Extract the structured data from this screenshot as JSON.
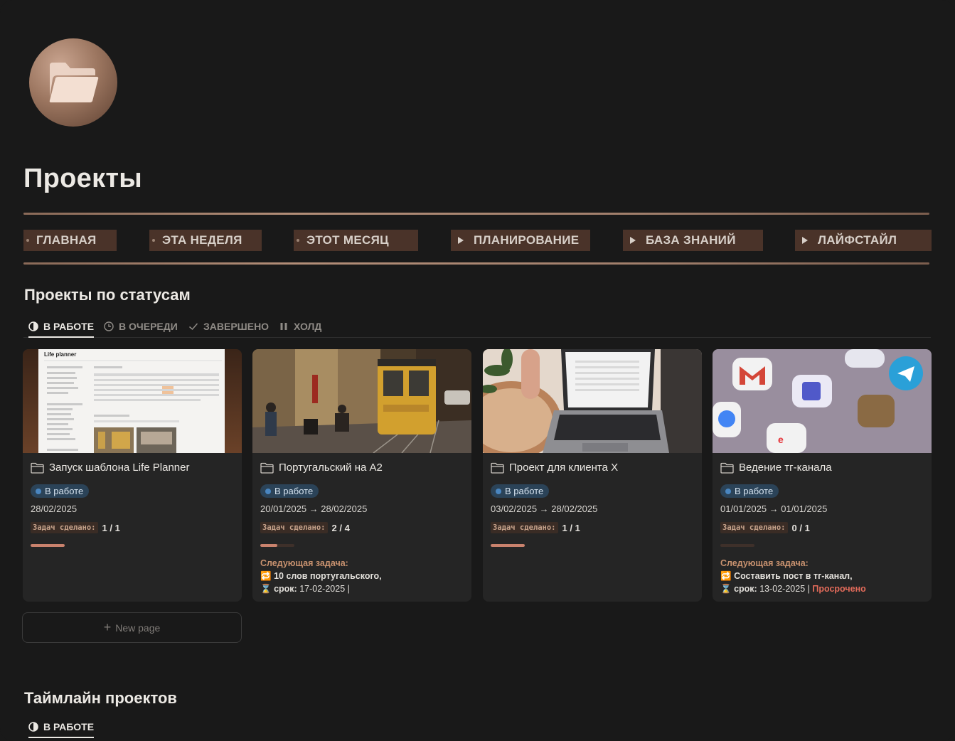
{
  "page": {
    "title": "Проекты",
    "icon": "folder-icon"
  },
  "nav": [
    {
      "label": "ГЛАВНАЯ",
      "marker": "bullet"
    },
    {
      "label": "ЭТА НЕДЕЛЯ",
      "marker": "bullet"
    },
    {
      "label": "ЭТОТ МЕСЯЦ",
      "marker": "bullet"
    },
    {
      "label": "ПЛАНИРОВАНИЕ",
      "marker": "triangle"
    },
    {
      "label": "БАЗА ЗНАНИЙ",
      "marker": "triangle"
    },
    {
      "label": "ЛАЙФСТАЙЛ",
      "marker": "triangle"
    }
  ],
  "status_section": {
    "title": "Проекты по статусам",
    "tabs": [
      {
        "label": "В РАБОТЕ",
        "icon": "half-circle-icon",
        "active": true
      },
      {
        "label": "В ОЧЕРЕДИ",
        "icon": "clock-icon",
        "active": false
      },
      {
        "label": "ЗАВЕРШЕНО",
        "icon": "check-icon",
        "active": false
      },
      {
        "label": "ХОЛД",
        "icon": "pause-icon",
        "active": false
      }
    ]
  },
  "cards": [
    {
      "title": "Запуск шаблона Life Planner",
      "cover": "life-planner-screenshot",
      "cover_text": "Life planner",
      "status": "В работе",
      "dates": "28/02/2025",
      "tasks_label": "Задач сделано:",
      "tasks_value": "1 / 1",
      "progress": 1.0,
      "next_task": null
    },
    {
      "title": "Португальский на А2",
      "cover": "lisbon-tram-photo",
      "status": "В работе",
      "dates": "20/01/2025 → 28/02/2025",
      "tasks_label": "Задач сделано:",
      "tasks_value": "2 / 4",
      "progress": 0.5,
      "next_task": {
        "heading": "Следующая задача:",
        "line1": "10 слов португальского,",
        "line2_label": "срок:",
        "line2_value": "17-02-2025 |",
        "overdue": ""
      }
    },
    {
      "title": "Проект для клиента Х",
      "cover": "laptop-desk-photo",
      "status": "В работе",
      "dates": "03/02/2025 → 28/02/2025",
      "tasks_label": "Задач сделано:",
      "tasks_value": "1 / 1",
      "progress": 1.0,
      "next_task": null
    },
    {
      "title": "Ведение тг-канала",
      "cover": "phone-apps-photo",
      "status": "В работе",
      "dates": "01/01/2025 → 01/01/2025",
      "tasks_label": "Задач сделано:",
      "tasks_value": "0 / 1",
      "progress": 0.0,
      "next_task": {
        "heading": "Следующая задача:",
        "line1": "Составить пост в тг-канал,",
        "line2_label": "срок:",
        "line2_value": "13-02-2025 |",
        "overdue": "Просрочено"
      }
    }
  ],
  "new_page_label": "New page",
  "timeline_section": {
    "title": "Таймлайн проектов",
    "tab": {
      "label": "В РАБОТЕ",
      "icon": "half-circle-icon"
    }
  },
  "colors": {
    "background": "#191919",
    "card": "#252525",
    "nav_bg": "#4a3329",
    "accent": "#c9826d",
    "status_badge": "#2b4358",
    "overdue": "#e36b5a"
  }
}
